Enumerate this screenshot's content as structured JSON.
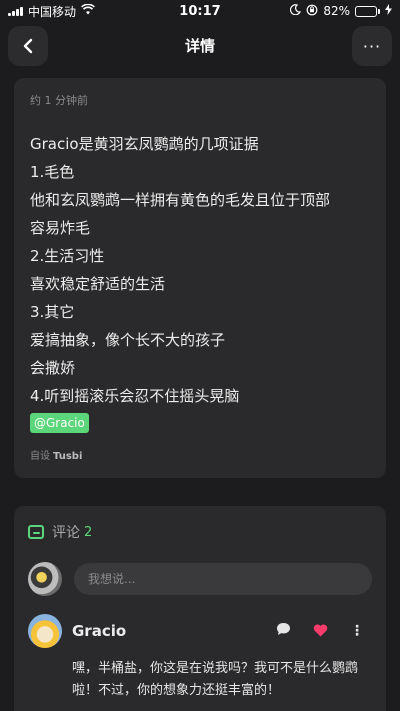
{
  "status_bar": {
    "carrier": "中国移动",
    "time": "10:17",
    "battery_percent": "82%",
    "battery_level": 0.82,
    "icons": [
      "signal-icon",
      "wifi-icon",
      "moon-icon",
      "orientation-lock-icon",
      "battery-icon",
      "charging-icon"
    ]
  },
  "nav": {
    "back_icon": "back-arrow-icon",
    "title": "详情",
    "more_icon": "more-icon"
  },
  "post": {
    "timestamp": "约 1 分钟前",
    "lines": [
      "Gracio是黄羽玄凤鹦鹉的几项证据",
      "1.毛色",
      "他和玄凤鹦鹉一样拥有黄色的毛发且位于顶部",
      "容易炸毛",
      "2.生活习性",
      "喜欢稳定舒适的生活",
      "3.其它",
      "爱搞抽象，像个长不大的孩子",
      "会撒娇",
      "4.听到摇滚乐会忍不住摇头晃脑"
    ],
    "mention": "@Gracio",
    "source_label": "自设",
    "source_name": "Tusbi"
  },
  "comments": {
    "title": "评论",
    "count": "2",
    "input_placeholder": "我想说...",
    "items": [
      {
        "author": "Gracio",
        "text": "嘿，半桶盐，你这是在说我吗？我可不是什么鹦鹉啦！不过，你的想象力还挺丰富的！"
      }
    ]
  },
  "colors": {
    "background": "#1c1c1e",
    "card": "#2a2a2c",
    "accent_green": "#5cd67a",
    "like_red": "#ff3b6b"
  }
}
